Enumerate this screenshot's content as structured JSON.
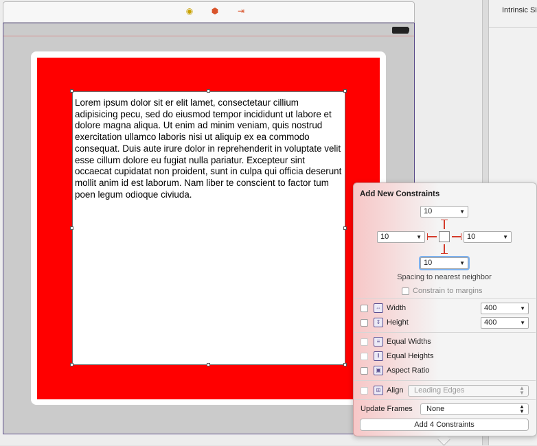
{
  "inspector": {
    "intrinsic_label": "Intrinsic Si"
  },
  "textview": {
    "text": "Lorem ipsum dolor sit er elit lamet, consectetaur cillium adipisicing pecu, sed do eiusmod tempor incididunt ut labore et dolore magna aliqua. Ut enim ad minim veniam, quis nostrud exercitation ullamco laboris nisi ut aliquip ex ea commodo consequat. Duis aute irure dolor in reprehenderit in voluptate velit esse cillum dolore eu fugiat nulla pariatur. Excepteur sint occaecat cupidatat non proident, sunt in culpa qui officia deserunt mollit anim id est laborum. Nam liber te conscient to factor tum poen legum odioque civiuda."
  },
  "colors": {
    "red_view": "#ff0000",
    "strut": "#d43a2a",
    "focus_ring": "#7db2ef",
    "scene_border": "#5a4c8a"
  },
  "popover": {
    "title": "Add New Constraints",
    "spacing": {
      "top": "10",
      "left": "10",
      "right": "10",
      "bottom": "10"
    },
    "spacing_label": "Spacing to nearest neighbor",
    "constrain_margins_label": "Constrain to margins",
    "width_label": "Width",
    "width_value": "400",
    "height_label": "Height",
    "height_value": "400",
    "equal_widths_label": "Equal Widths",
    "equal_heights_label": "Equal Heights",
    "aspect_ratio_label": "Aspect Ratio",
    "align_label": "Align",
    "align_value": "Leading Edges",
    "update_frames_label": "Update Frames",
    "update_frames_value": "None",
    "add_button_label": "Add 4 Constraints"
  },
  "icons": {
    "dock": [
      "view-controller-icon",
      "first-responder-icon",
      "exit-icon"
    ],
    "battery": "battery-icon"
  }
}
